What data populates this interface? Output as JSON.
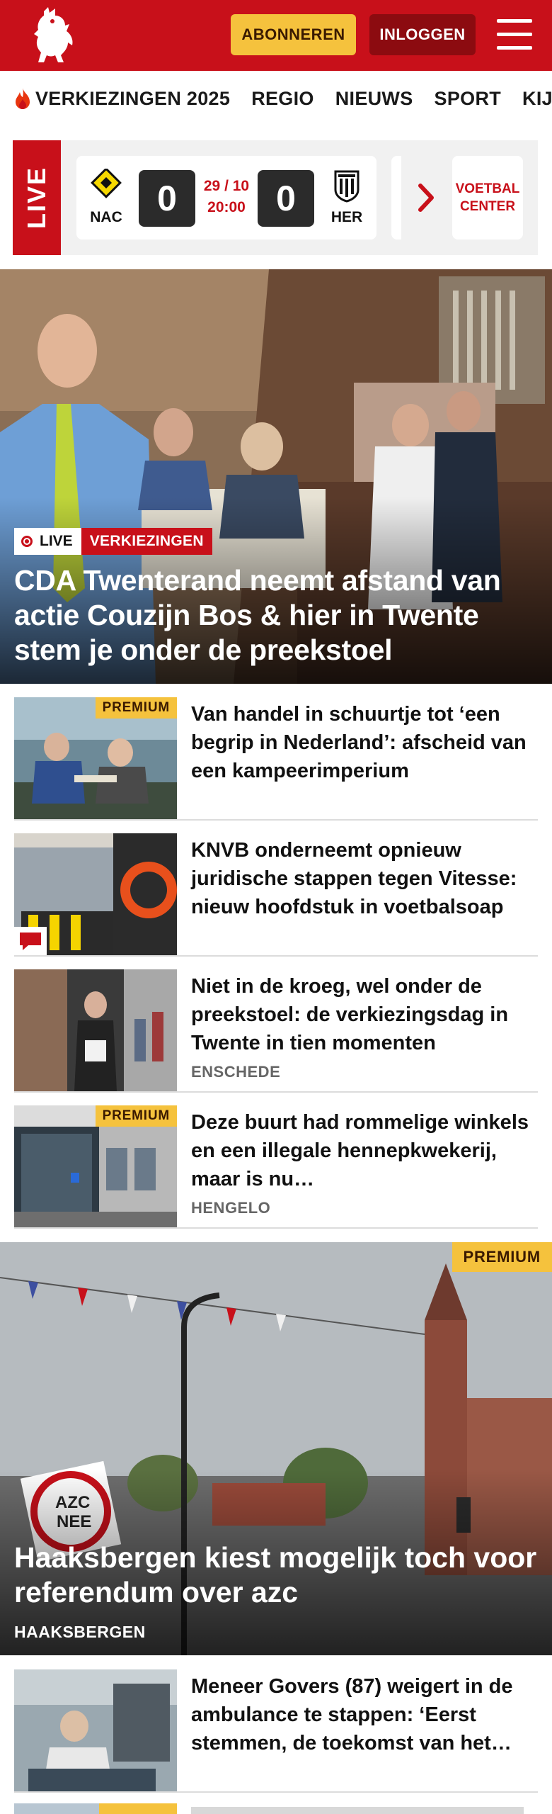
{
  "header": {
    "subscribe_label": "ABONNEREN",
    "login_label": "INLOGGEN"
  },
  "nav": {
    "items": [
      "VERKIEZINGEN 2025",
      "REGIO",
      "NIEUWS",
      "SPORT",
      "KIJK"
    ]
  },
  "live": {
    "tag": "LIVE",
    "match": {
      "home": "NAC",
      "away": "HER",
      "home_score": "0",
      "away_score": "0",
      "date": "29 / 10",
      "time": "20:00"
    },
    "center_line1": "VOETBAL",
    "center_line2": "CENTER"
  },
  "hero": {
    "live_label": "LIVE",
    "category": "VERKIEZINGEN",
    "title": "CDA Twenterand neemt afstand van actie Couzijn Bos & hier in Twente stem je onder de preekstoel"
  },
  "articles": [
    {
      "title": "Van handel in schuurtje tot ‘een begrip in Nederland’: afscheid van een kampeerimperium",
      "premium": "PREMIUM",
      "location": ""
    },
    {
      "title": "KNVB onderneemt opnieuw juridische stappen tegen Vitesse: nieuw hoofdstuk in voetbalsoap",
      "premium": "",
      "location": ""
    },
    {
      "title": "Niet in de kroeg, wel onder de preekstoel: de verkiezingsdag in Twente in tien momenten",
      "premium": "",
      "location": "ENSCHEDE"
    },
    {
      "title": "Deze buurt had rommelige winkels en een illegale hennepkwekerij, maar is nu…",
      "premium": "PREMIUM",
      "location": "HENGELO"
    }
  ],
  "feature": {
    "premium": "PREMIUM",
    "title": "Haaksbergen kiest mogelijk toch voor referendum over azc",
    "location": "HAAKSBERGEN",
    "sign_text": "AZC NEE"
  },
  "bottom_articles": [
    {
      "title": "Meneer Govers (87) weigert in de ambulance te stappen: ‘Eerst stemmen, de toekomst van het…",
      "premium": ""
    }
  ],
  "colors": {
    "brand_red": "#c8101a",
    "premium_yellow": "#f5c23d",
    "login_dark_red": "#8c0b10"
  }
}
